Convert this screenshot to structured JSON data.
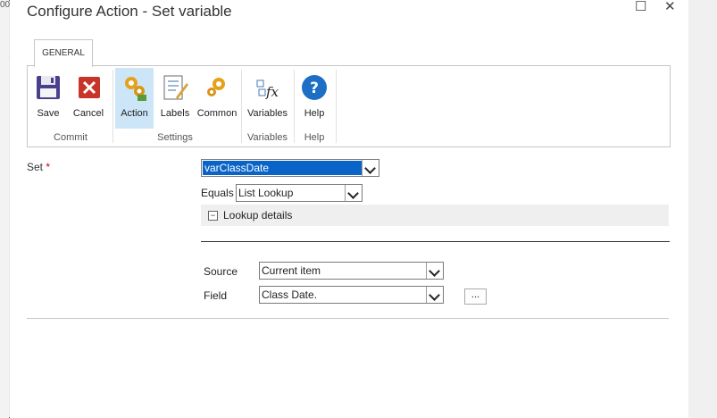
{
  "window": {
    "title": "Configure Action - Set variable",
    "maximize_glyph": "☐",
    "close_glyph": "✕"
  },
  "background": {
    "left_glyph": "00"
  },
  "ribbon": {
    "tab": "GENERAL",
    "buttons": [
      {
        "label": "Save",
        "icon": "save-icon"
      },
      {
        "label": "Cancel",
        "icon": "cancel-icon"
      },
      {
        "label": "Action",
        "icon": "gears-icon",
        "active": true
      },
      {
        "label": "Labels",
        "icon": "labels-icon"
      },
      {
        "label": "Common",
        "icon": "common-gear-icon"
      },
      {
        "label": "Variables",
        "icon": "variables-icon"
      },
      {
        "label": "Help",
        "icon": "help-icon"
      }
    ],
    "groups": [
      "Commit",
      "Settings",
      "Variables",
      "Help"
    ]
  },
  "form": {
    "set_label": "Set",
    "required_marker": "*",
    "set_value": "varClassDate",
    "equals_label": "Equals",
    "equals_value": "List Lookup",
    "lookup": {
      "toggle_glyph": "−",
      "title": "Lookup details"
    },
    "source_label": "Source",
    "source_value": "Current item",
    "field_label": "Field",
    "field_value": "Class Date.",
    "ellipsis_label": "..."
  },
  "colors": {
    "selection": "#0a64c8",
    "active_button": "#cde6f7",
    "frame_border": "#d42020"
  }
}
